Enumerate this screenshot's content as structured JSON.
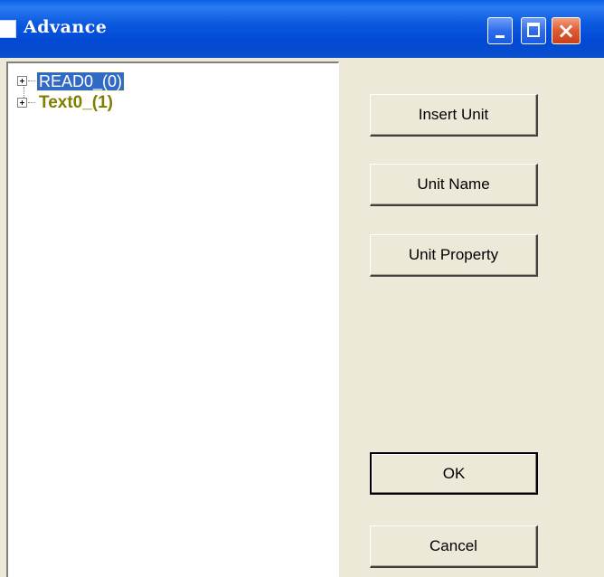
{
  "window": {
    "title": "Advance",
    "minimize_glyph": "",
    "close_glyph": "×"
  },
  "tree": {
    "items": [
      {
        "label": "READ0_(0)",
        "selected": true
      },
      {
        "label": "Text0_(1)",
        "selected": false
      }
    ]
  },
  "buttons": {
    "insert_unit": "Insert Unit",
    "unit_name": "Unit Name",
    "unit_property": "Unit Property",
    "ok": "OK",
    "cancel": "Cancel"
  },
  "colors": {
    "titlebar": "#0A5FE8",
    "selection": "#316AC5",
    "text1": "#808000",
    "face": "#ECE9D8"
  }
}
